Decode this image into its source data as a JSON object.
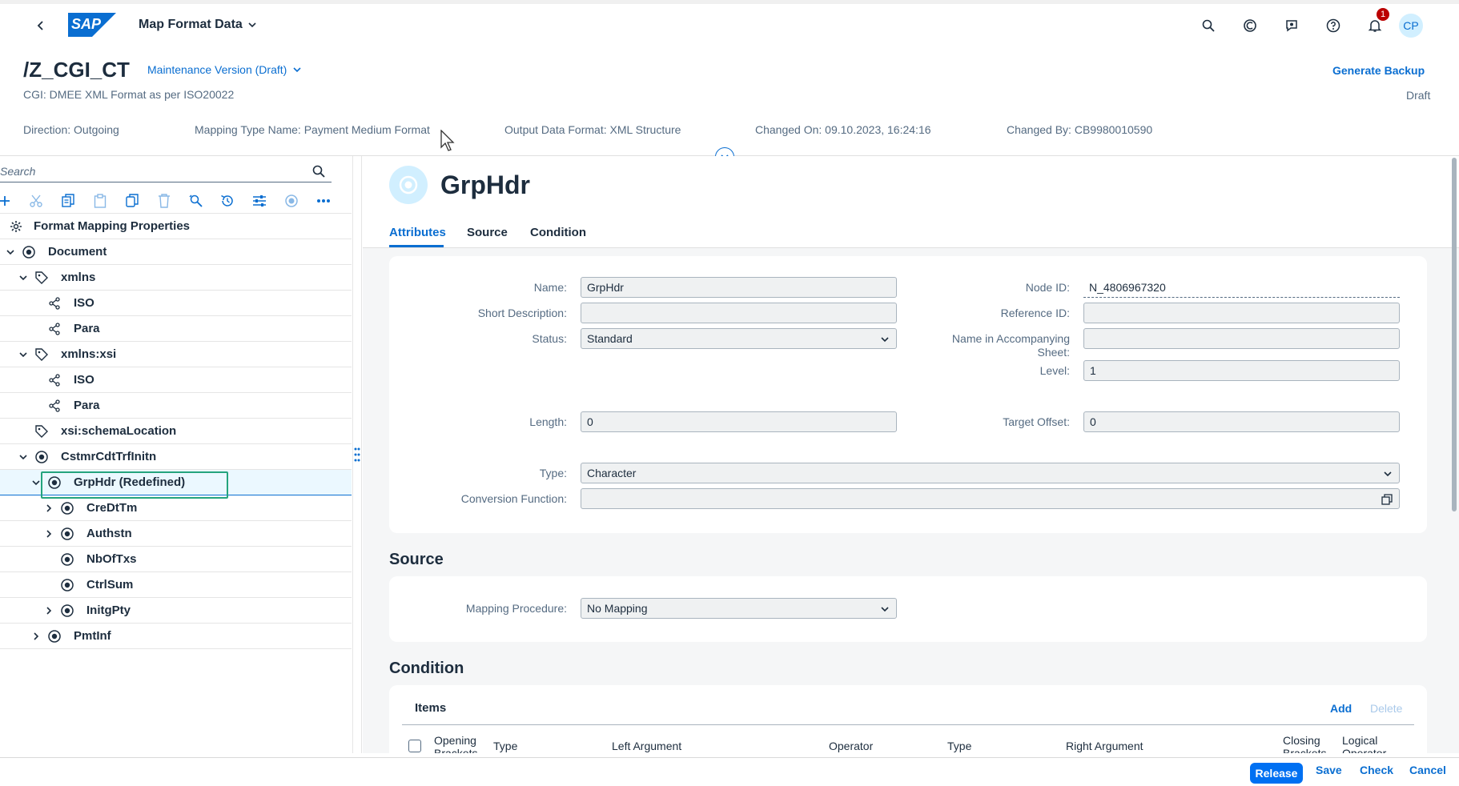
{
  "shell": {
    "app_title": "Map Format Data",
    "logo_text": "SAP",
    "notification_count": "1",
    "user_initials": "CP"
  },
  "header": {
    "object_title": "/Z_CGI_CT",
    "version": "Maintenance Version (Draft)",
    "subtitle": "CGI: DMEE XML Format as per ISO20022",
    "generate_backup": "Generate Backup",
    "status": "Draft",
    "attributes": [
      "Direction: Outgoing",
      "Mapping Type Name: Payment Medium Format",
      "Output Data Format: XML Structure",
      "Changed On: 09.10.2023, 16:24:16",
      "Changed By: CB9980010590"
    ]
  },
  "tree": {
    "search_placeholder": "Search",
    "root": "Format Mapping Properties",
    "items": [
      {
        "label": "Document"
      },
      {
        "label": "xmlns"
      },
      {
        "label": "ISO"
      },
      {
        "label": "Para"
      },
      {
        "label": "xmlns:xsi"
      },
      {
        "label": "ISO"
      },
      {
        "label": "Para"
      },
      {
        "label": "xsi:schemaLocation"
      },
      {
        "label": "CstmrCdtTrfInitn"
      },
      {
        "label": "GrpHdr (Redefined)"
      },
      {
        "label": "CreDtTm"
      },
      {
        "label": "Authstn"
      },
      {
        "label": "NbOfTxs"
      },
      {
        "label": "CtrlSum"
      },
      {
        "label": "InitgPty"
      },
      {
        "label": "PmtInf"
      }
    ]
  },
  "detail": {
    "title": "GrpHdr",
    "tabs": [
      "Attributes",
      "Source",
      "Condition"
    ],
    "fields": {
      "name_label": "Name:",
      "name_value": "GrpHdr",
      "short_desc_label": "Short Description:",
      "short_desc_value": "",
      "status_label": "Status:",
      "status_value": "Standard",
      "node_id_label": "Node ID:",
      "node_id_value": "N_4806967320",
      "ref_id_label": "Reference ID:",
      "ref_id_value": "",
      "name_acc_label_1": "Name in Accompanying",
      "name_acc_label_2": "Sheet:",
      "name_acc_value": "",
      "level_label": "Level:",
      "level_value": "1",
      "length_label": "Length:",
      "length_value": "0",
      "target_offset_label": "Target Offset:",
      "target_offset_value": "0",
      "type_label": "Type:",
      "type_value": "Character",
      "conv_label": "Conversion Function:",
      "conv_value": ""
    },
    "source": {
      "section_title": "Source",
      "mapping_label": "Mapping Procedure:",
      "mapping_value": "No Mapping"
    },
    "condition": {
      "section_title": "Condition",
      "items_title": "Items",
      "add": "Add",
      "delete": "Delete",
      "columns": [
        "Opening Brackets",
        "Type",
        "Left Argument",
        "Operator",
        "Type",
        "Right Argument",
        "Closing Brackets",
        "Logical Operator"
      ]
    }
  },
  "footer": {
    "release": "Release",
    "save": "Save",
    "check": "Check",
    "cancel": "Cancel"
  }
}
